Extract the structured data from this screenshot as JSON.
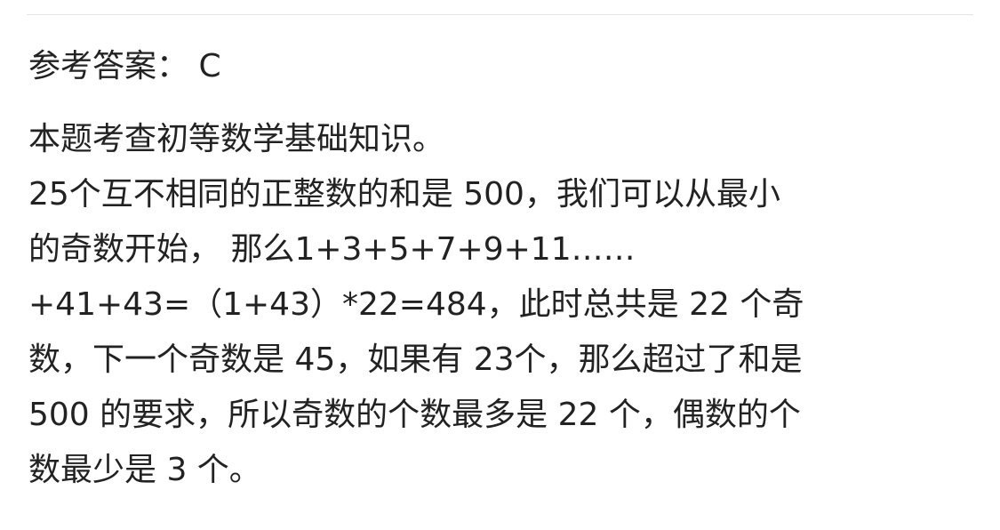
{
  "answer": {
    "label": "参考答案： C"
  },
  "explanation": {
    "lines": [
      "本题考查初等数学基础知识。",
      "25个互不相同的正整数的和是 500，我们可以从最小",
      "的奇数开始， 那么1+3+5+7+9+11……",
      "+41+43=（1+43）*22=484，此时总共是 22 个奇",
      "数，下一个奇数是 45，如果有 23个，那么超过了和是",
      "500 的要求，所以奇数的个数最多是 22 个，偶数的个",
      "数最少是 3 个。"
    ]
  }
}
